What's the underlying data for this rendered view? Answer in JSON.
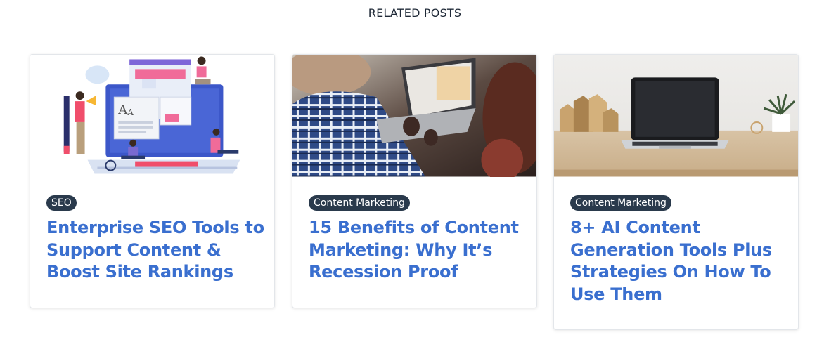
{
  "section": {
    "title": "RELATED POSTS"
  },
  "posts": [
    {
      "category": "SEO",
      "title": "Enterprise SEO Tools to Support Content & Boost Site Rankings"
    },
    {
      "category": "Content Marketing",
      "title": "15 Benefits of Content Marketing: Why It’s Recession Proof"
    },
    {
      "category": "Content Marketing",
      "title": "8+ AI Content Generation Tools Plus Strategies On How To Use Them"
    }
  ],
  "colors": {
    "title_link": "#3a6fcf",
    "badge_bg": "#2a3a4c",
    "badge_text": "#ffffff"
  }
}
